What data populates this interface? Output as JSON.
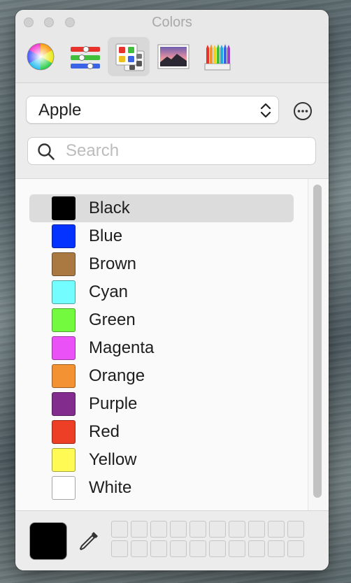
{
  "window": {
    "title": "Colors"
  },
  "toolbar": {
    "tools": [
      "color-wheel",
      "color-sliders",
      "color-palettes",
      "image-palettes",
      "pencils"
    ],
    "selected": "color-palettes"
  },
  "palette": {
    "selected_value": "Apple"
  },
  "search": {
    "placeholder": "Search",
    "value": ""
  },
  "colors": [
    {
      "name": "Black",
      "hex": "#000000",
      "selected": true
    },
    {
      "name": "Blue",
      "hex": "#0433ff",
      "selected": false
    },
    {
      "name": "Brown",
      "hex": "#aa7942",
      "selected": false
    },
    {
      "name": "Cyan",
      "hex": "#73fdff",
      "selected": false
    },
    {
      "name": "Green",
      "hex": "#73fa3f",
      "selected": false
    },
    {
      "name": "Magenta",
      "hex": "#ea52f7",
      "selected": false
    },
    {
      "name": "Orange",
      "hex": "#f29232",
      "selected": false
    },
    {
      "name": "Purple",
      "hex": "#822d8d",
      "selected": false
    },
    {
      "name": "Red",
      "hex": "#ec3f25",
      "selected": false
    },
    {
      "name": "Yellow",
      "hex": "#fffb54",
      "selected": false
    },
    {
      "name": "White",
      "hex": "#ffffff",
      "selected": false
    }
  ],
  "current_color": "#000000"
}
